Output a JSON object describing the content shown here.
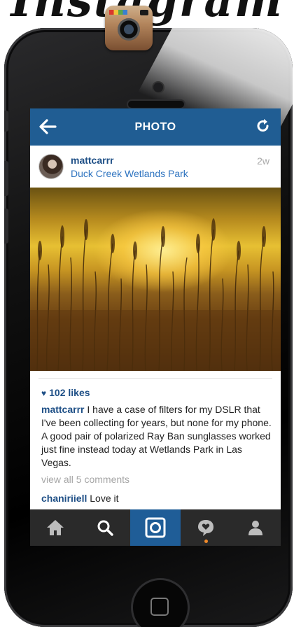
{
  "logo_text": "Instagram",
  "nav": {
    "title": "PHOTO",
    "back_icon": "back-arrow-icon",
    "refresh_icon": "refresh-icon"
  },
  "post": {
    "username": "mattcarrr",
    "location": "Duck Creek Wetlands Park",
    "time_ago": "2w",
    "likes": "102 likes",
    "caption_user": "mattcarrr",
    "caption_text": " I have a case of filters for my DSLR that I've been collecting for years, but none for my phone. A good pair of polarized Ray Ban sunglasses worked just fine instead today at Wetlands Park in Las Vegas.",
    "view_comments": "view all 5 comments",
    "comments": [
      {
        "user": "chaniriiell",
        "text": " Love it"
      }
    ]
  },
  "tabbar": {
    "tabs": [
      {
        "name": "home",
        "icon": "home-icon",
        "active": false
      },
      {
        "name": "explore",
        "icon": "search-icon",
        "active": false
      },
      {
        "name": "camera",
        "icon": "camera-icon",
        "active": true
      },
      {
        "name": "activity",
        "icon": "heart-bubble-icon",
        "active": false,
        "notification": true
      },
      {
        "name": "profile",
        "icon": "profile-icon",
        "active": false
      }
    ]
  },
  "colors": {
    "nav_bar": "#205d93",
    "link": "#1e4f86",
    "tabbar": "#2a2a2a",
    "tab_active": "#1f5d97",
    "notification_dot": "#f08a2a"
  }
}
